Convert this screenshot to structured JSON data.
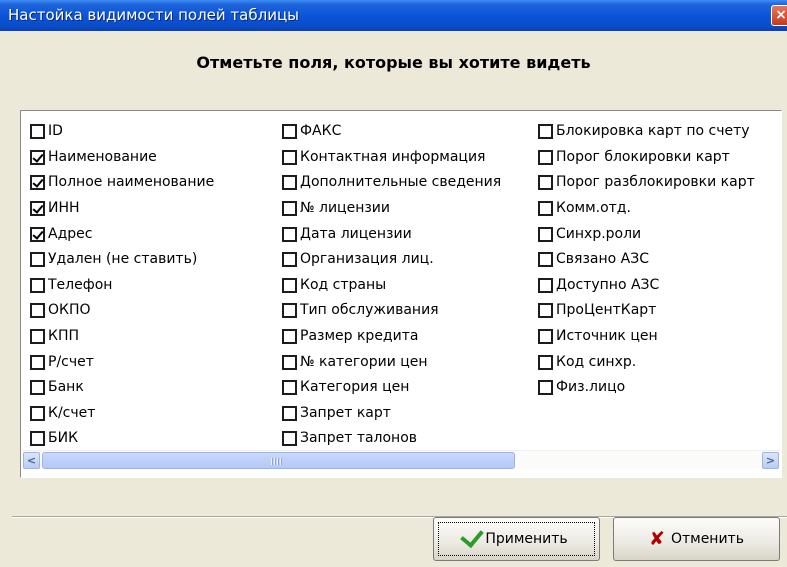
{
  "window": {
    "title": "Настойка видимости полей таблицы",
    "close_label": "×"
  },
  "heading": "Отметьте поля, которые вы хотите  видеть",
  "columns": [
    [
      {
        "label": "ID",
        "checked": false
      },
      {
        "label": "Наименование",
        "checked": true
      },
      {
        "label": "Полное наименование",
        "checked": true
      },
      {
        "label": "ИНН",
        "checked": true
      },
      {
        "label": "Адрес",
        "checked": true
      },
      {
        "label": "Удален (не ставить)",
        "checked": false
      },
      {
        "label": "Телефон",
        "checked": false
      },
      {
        "label": "ОКПО",
        "checked": false
      },
      {
        "label": "КПП",
        "checked": false
      },
      {
        "label": "Р/счет",
        "checked": false
      },
      {
        "label": "Банк",
        "checked": false
      },
      {
        "label": "К/счет",
        "checked": false
      },
      {
        "label": "БИК",
        "checked": false
      }
    ],
    [
      {
        "label": "ФАКС",
        "checked": false
      },
      {
        "label": "Контактная информация",
        "checked": false
      },
      {
        "label": "Дополнительные сведения",
        "checked": false
      },
      {
        "label": "№ лицензии",
        "checked": false
      },
      {
        "label": "Дата лицензии",
        "checked": false
      },
      {
        "label": "Организация лиц.",
        "checked": false
      },
      {
        "label": "Код страны",
        "checked": false
      },
      {
        "label": "Тип обслуживания",
        "checked": false
      },
      {
        "label": "Размер кредита",
        "checked": false
      },
      {
        "label": "№ категории цен",
        "checked": false
      },
      {
        "label": "Категория цен",
        "checked": false
      },
      {
        "label": "Запрет карт",
        "checked": false
      },
      {
        "label": "Запрет талонов",
        "checked": false
      }
    ],
    [
      {
        "label": "Блокировка карт по счету",
        "checked": false
      },
      {
        "label": "Порог блокировки карт",
        "checked": false
      },
      {
        "label": "Порог разблокировки карт",
        "checked": false
      },
      {
        "label": "Комм.отд.",
        "checked": false
      },
      {
        "label": "Синхр.роли",
        "checked": false
      },
      {
        "label": "Связано АЗС",
        "checked": false
      },
      {
        "label": "Доступно АЗС",
        "checked": false
      },
      {
        "label": "ПроЦентКарт",
        "checked": false
      },
      {
        "label": "Источник цен",
        "checked": false
      },
      {
        "label": "Код синхр.",
        "checked": false
      },
      {
        "label": "Физ.лицо",
        "checked": false
      }
    ]
  ],
  "scrollbar": {
    "left_arrow": "<",
    "right_arrow": ">"
  },
  "buttons": {
    "apply": "Применить",
    "cancel": "Отменить",
    "apply_icon": "check-icon",
    "cancel_icon": "x-icon"
  },
  "colors": {
    "title_bar": "#0a55d9",
    "window_bg": "#ece9d8",
    "apply_icon": "#2d9a2d",
    "cancel_icon": "#b00000"
  }
}
